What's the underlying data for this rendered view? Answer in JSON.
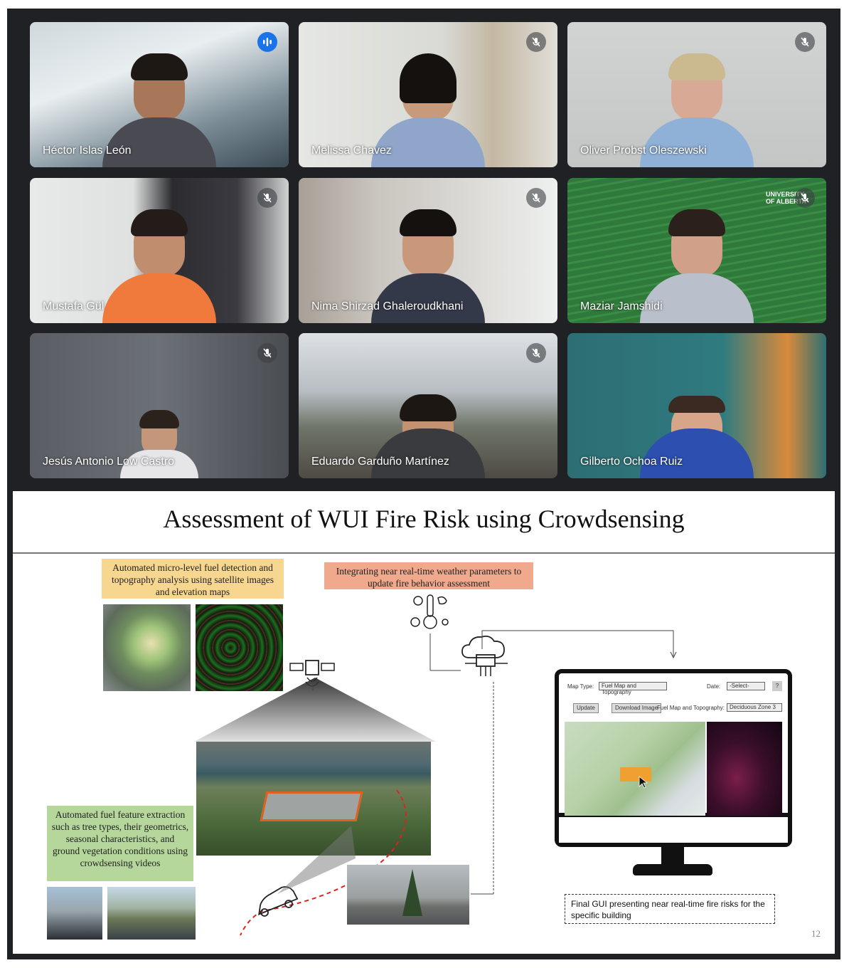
{
  "participants": [
    {
      "name": "Héctor Islas León",
      "speaking": true
    },
    {
      "name": "Melissa Chavez",
      "muted": true
    },
    {
      "name": "Oliver Probst Oleszewski",
      "muted": true
    },
    {
      "name": "Mustafa Gül",
      "muted": true
    },
    {
      "name": "Nima Shirzad Ghaleroudkhani",
      "muted": true
    },
    {
      "name": "Maziar Jamshidi",
      "muted": true,
      "logo": [
        "UNIVERSITY",
        "OF ALBERTA"
      ]
    },
    {
      "name": "Jesús Antonio Low Castro",
      "muted": true
    },
    {
      "name": "Eduardo Garduño Martínez",
      "muted": true
    },
    {
      "name": "Gilberto Ochoa Ruiz"
    }
  ],
  "slide": {
    "title": "Assessment of WUI Fire Risk using Crowdsensing",
    "box_fuel_detection": "Automated micro-level fuel detection and topography analysis using satellite images and elevation maps",
    "box_weather": "Integrating near real-time weather parameters to update fire behavior assessment",
    "box_fuel_features": "Automated fuel feature extraction such as tree types, their geometrics, seasonal characteristics, and ground vegetation conditions using crowdsensing videos",
    "gui": {
      "map_type_label": "Map Type:",
      "map_type_value": "Fuel Map and Topography",
      "date_label": "Date:",
      "date_value": "-Select-",
      "help": "?",
      "update_button": "Update",
      "download_button": "Download Image",
      "fuel_label": "Fuel Map and Topography:",
      "fuel_value": "Deciduous Zone 3"
    },
    "caption": "Final GUI presenting near real-time fire risks for the specific building",
    "page_number": "12"
  },
  "colors": {
    "active_outline": "#8ab4f8",
    "speaking": "#1a73e8",
    "yellow_box": "#f7d78f",
    "salmon_box": "#f0a98c",
    "green_box": "#b5d79b"
  }
}
